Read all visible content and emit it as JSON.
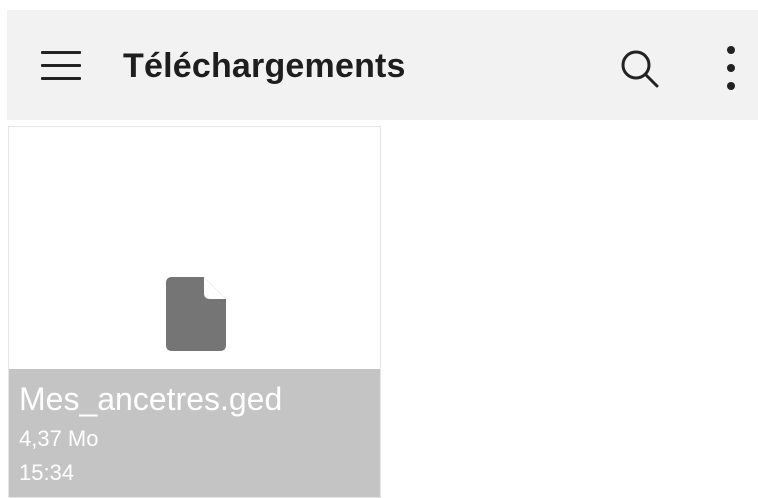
{
  "toolbar": {
    "title": "Téléchargements",
    "menu_icon": "hamburger-menu-icon",
    "search_icon": "search-icon",
    "more_icon": "more-vertical-icon",
    "background": "#f2f2f2"
  },
  "files": [
    {
      "name": "Mes_ancetres.ged",
      "size": "4,37 Mo",
      "time": "15:34",
      "icon": "document-icon",
      "icon_color": "#757575",
      "info_background": "#c4c4c4"
    }
  ]
}
